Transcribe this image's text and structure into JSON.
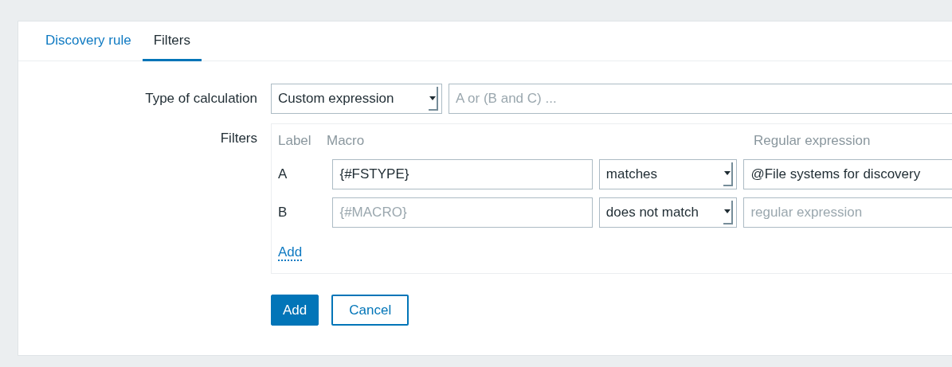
{
  "tabs": [
    {
      "label": "Discovery rule",
      "selected": false
    },
    {
      "label": "Filters",
      "selected": true
    }
  ],
  "calculation": {
    "label": "Type of calculation",
    "value": "Custom expression",
    "expression_placeholder": "A or (B and C) ..."
  },
  "filters": {
    "label": "Filters",
    "columns": [
      "Label",
      "Macro",
      "Regular expression"
    ],
    "rows": [
      {
        "label": "A",
        "macro": {
          "value": "{#FSTYPE}"
        },
        "operator": "matches",
        "regex": {
          "value": "@File systems for discovery"
        }
      },
      {
        "label": "B",
        "macro": {
          "placeholder": "{#MACRO}"
        },
        "operator": "does not match",
        "regex": {
          "placeholder": "regular expression"
        }
      }
    ],
    "add_link": "Add"
  },
  "buttons": [
    {
      "label": "Add",
      "kind": "primary"
    },
    {
      "label": "Cancel",
      "kind": "secondary"
    }
  ]
}
